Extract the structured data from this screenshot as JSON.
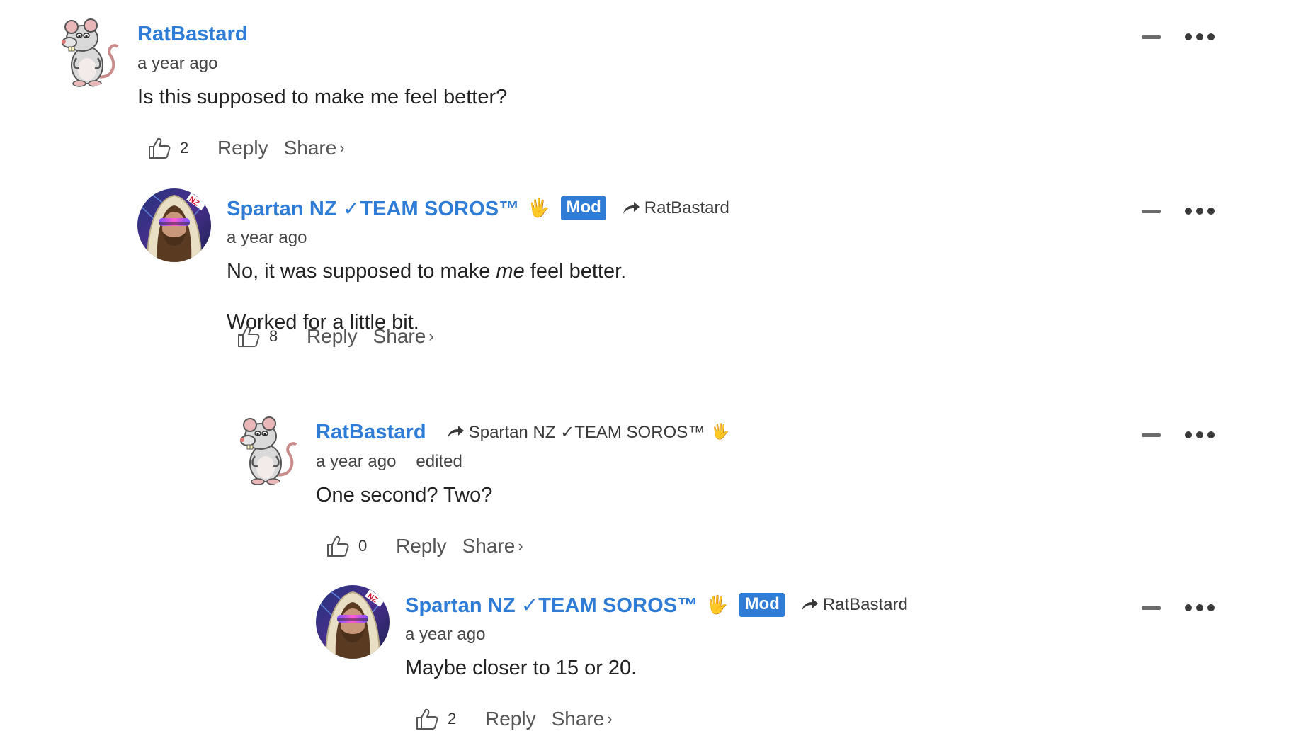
{
  "comments": [
    {
      "author": "RatBastard",
      "time": "a year ago",
      "body": [
        "Is this supposed to make me feel better?"
      ],
      "likes": "2",
      "reply_label": "Reply",
      "share_label": "Share"
    },
    {
      "author": "Spartan NZ ✓TEAM SOROS™",
      "badge": "Mod",
      "reply_to": "RatBastard",
      "time": "a year ago",
      "body_p1_before": "No, it was supposed to make ",
      "body_p1_em": "me",
      "body_p1_after": " feel better.",
      "body_p2": "Worked for a little bit.",
      "likes": "8",
      "reply_label": "Reply",
      "share_label": "Share"
    },
    {
      "author": "RatBastard",
      "reply_to": "Spartan NZ ✓TEAM SOROS™",
      "time": "a year ago",
      "edited": "edited",
      "body": [
        "One second? Two?"
      ],
      "likes": "0",
      "reply_label": "Reply",
      "share_label": "Share"
    },
    {
      "author": "Spartan NZ ✓TEAM SOROS™",
      "badge": "Mod",
      "reply_to": "RatBastard",
      "time": "a year ago",
      "body": [
        "Maybe closer to 15 or 20."
      ],
      "likes": "2",
      "reply_label": "Reply",
      "share_label": "Share"
    }
  ],
  "icons": {
    "like": "thumbs-up-outline-icon",
    "collapse": "minus-icon",
    "more": "ellipsis-icon",
    "reply_to": "curved-arrow-icon",
    "hand": "raised-hand-icon"
  },
  "colors": {
    "author": "#2e7cd6",
    "mod_badge": "#2e7cd6",
    "text": "#222222",
    "meta": "#444444"
  }
}
